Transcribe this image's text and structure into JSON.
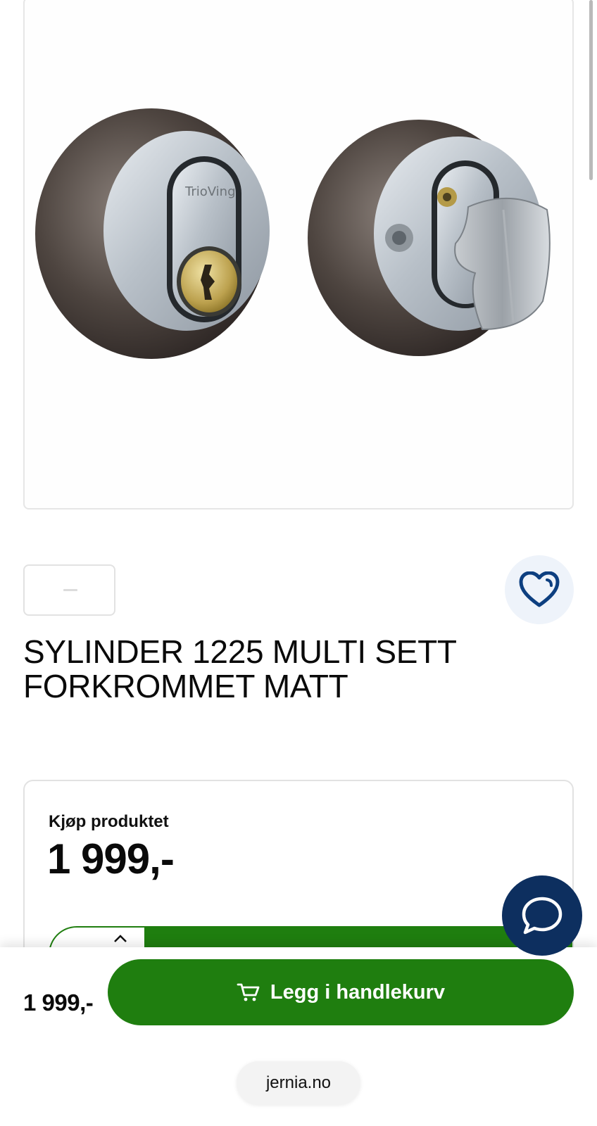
{
  "product": {
    "title": "SYLINDER 1225 MULTI SETT FORKROMMET MATT",
    "image_brand_text": "TrioVing",
    "favorite_icon": "heart-icon"
  },
  "purchase": {
    "heading": "Kjøp produktet",
    "price": "1 999,-",
    "quantity_increase_icon": "chevron-up-icon"
  },
  "sticky_bar": {
    "price": "1 999,-",
    "add_to_cart_label": "Legg i handlekurv",
    "cart_icon": "cart-icon"
  },
  "chat": {
    "icon": "chat-bubble-icon"
  },
  "browser": {
    "domain": "jernia.no"
  },
  "colors": {
    "primary_green": "#1f7e0f",
    "chat_navy": "#0d2f5f",
    "favorite_bg": "#eef3fa",
    "heart_blue": "#0d3f80"
  }
}
